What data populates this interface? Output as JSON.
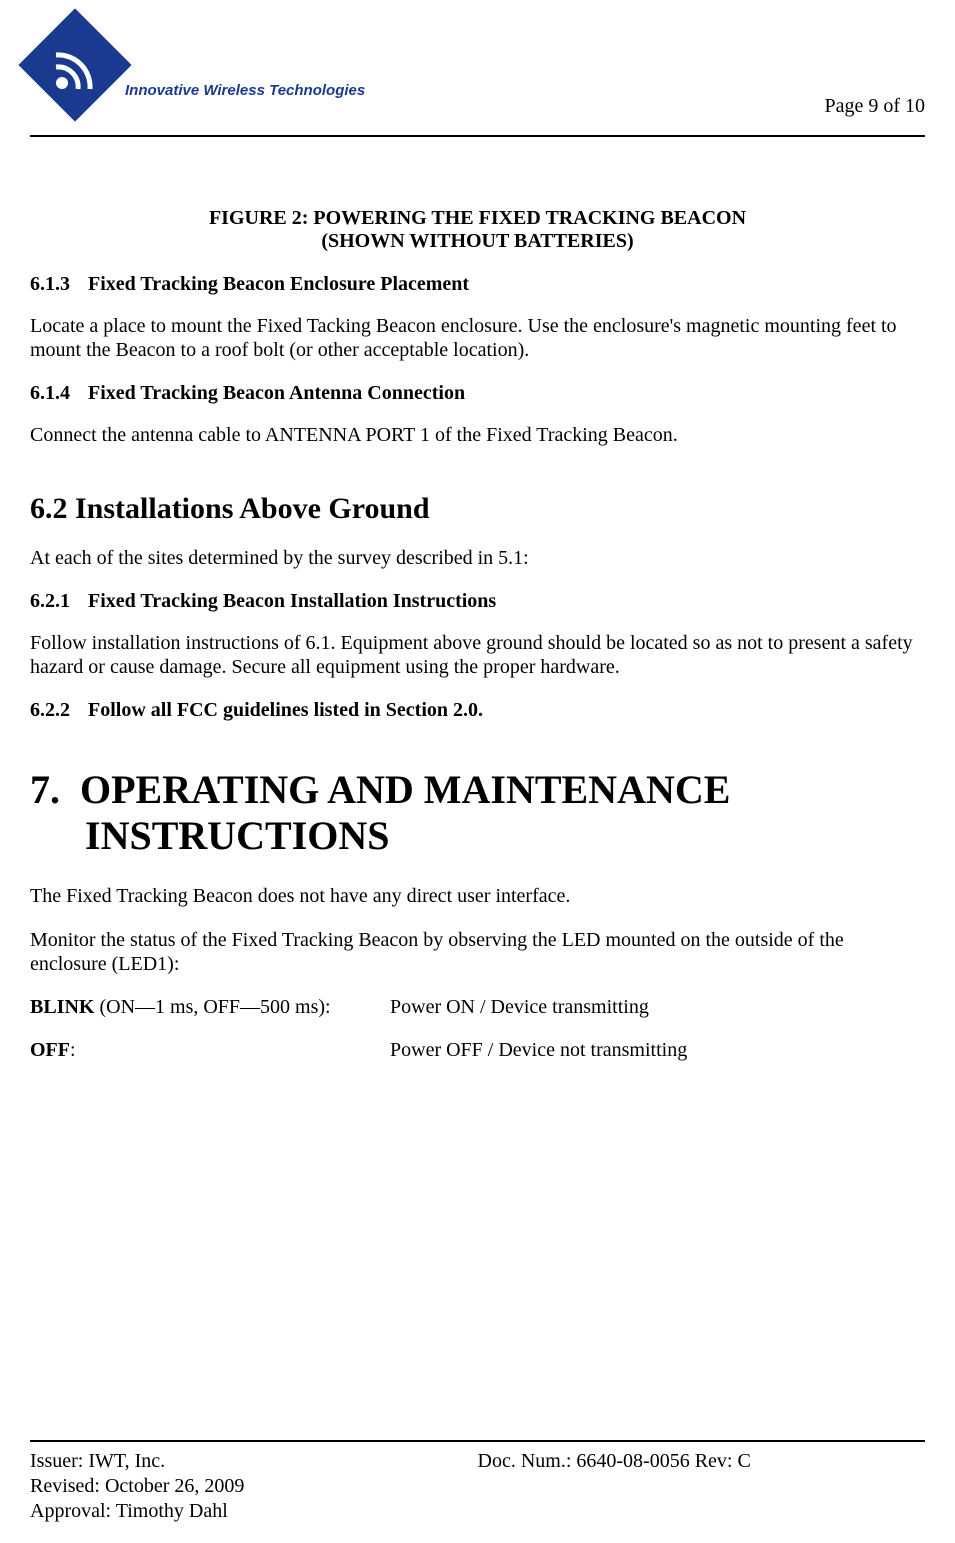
{
  "header": {
    "logo_text": "Innovative Wireless Technologies",
    "page_label": "Page 9 of 10"
  },
  "figure": {
    "line1": "FIGURE 2:  POWERING THE FIXED TRACKING BEACON",
    "line2": "(SHOWN WITHOUT BATTERIES)"
  },
  "sections": {
    "s613": {
      "num": "6.1.3",
      "title": "Fixed Tracking Beacon Enclosure Placement",
      "body": "Locate a place to mount the Fixed Tacking Beacon enclosure.  Use the enclosure's magnetic mounting feet to mount the Beacon to a roof bolt (or other acceptable location)."
    },
    "s614": {
      "num": "6.1.4",
      "title": "Fixed Tracking Beacon Antenna Connection",
      "body": "Connect the antenna cable to ANTENNA PORT 1 of the Fixed Tracking Beacon."
    },
    "s62": {
      "num": "6.2",
      "title": "Installations Above Ground",
      "body": "At each of the sites determined by the survey described in 5.1:"
    },
    "s621": {
      "num": "6.2.1",
      "title": "Fixed Tracking Beacon Installation Instructions",
      "body": "Follow installation instructions of 6.1.  Equipment above ground should be located so as not to present a safety hazard or cause damage.  Secure all equipment using the proper hardware."
    },
    "s622": {
      "num": "6.2.2",
      "title": "Follow all FCC guidelines listed in Section 2.0."
    },
    "chapter7": {
      "num": "7.",
      "title1": "OPERATING AND MAINTENANCE",
      "title2": "INSTRUCTIONS",
      "body1": "The Fixed Tracking Beacon does not have any direct user interface.",
      "body2": "Monitor the status of the Fixed Tracking Beacon by observing the LED mounted on the outside of the enclosure (LED1):"
    }
  },
  "status": {
    "blink": {
      "label_bold": "BLINK",
      "label_rest": " (ON—1 ms, OFF—500 ms):",
      "value": "Power ON / Device transmitting"
    },
    "off": {
      "label_bold": "OFF",
      "label_rest": ":",
      "value": "Power OFF / Device not transmitting"
    }
  },
  "footer": {
    "issuer": "Issuer: IWT, Inc.",
    "docnum": "Doc.  Num.: 6640-08-0056 Rev: C",
    "revised": "Revised:  October 26, 2009",
    "approval": "Approval: Timothy Dahl"
  }
}
